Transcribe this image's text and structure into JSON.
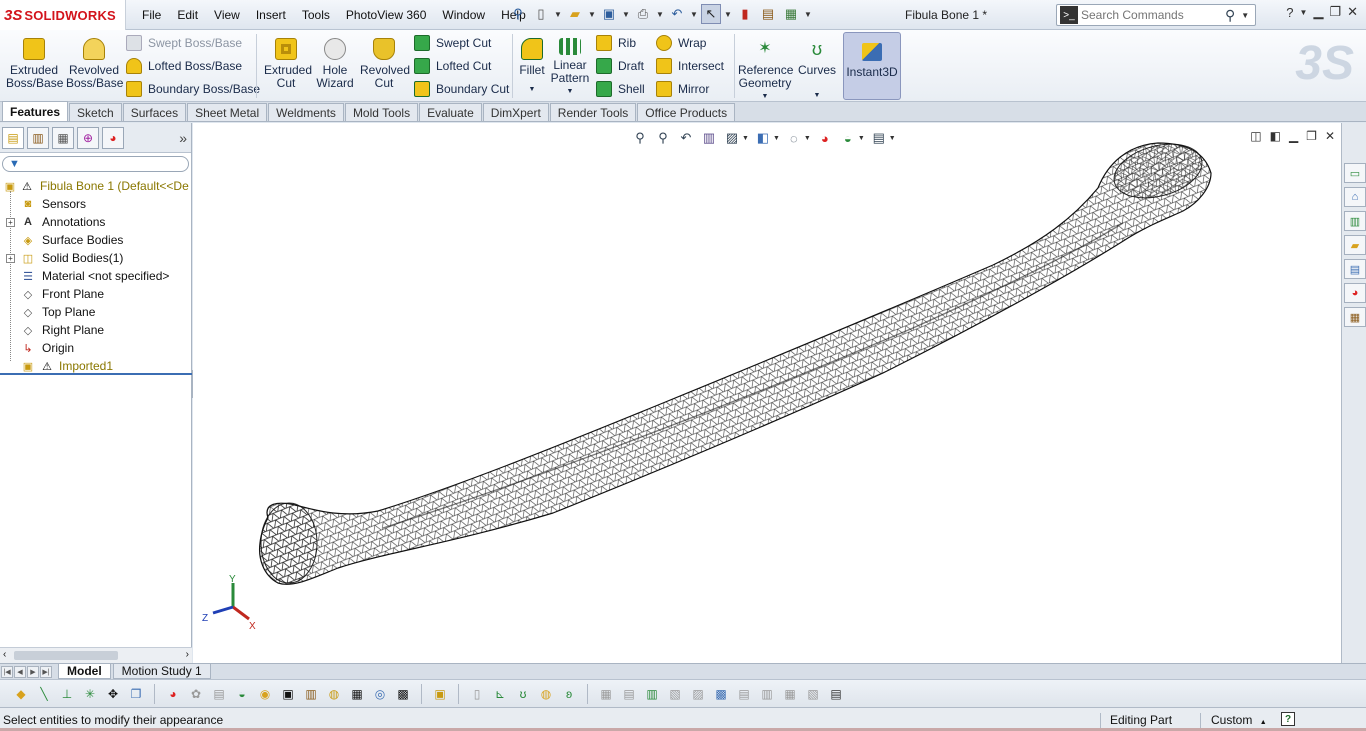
{
  "app": {
    "logo_mark": "3S",
    "logo_text": "SOLIDWORKS",
    "document_title": "Fibula Bone 1 *"
  },
  "menu": {
    "items": [
      "File",
      "Edit",
      "View",
      "Insert",
      "Tools",
      "PhotoView 360",
      "Window",
      "Help"
    ]
  },
  "search": {
    "placeholder": "Search Commands"
  },
  "command_manager": {
    "extruded_boss": "Extruded Boss/Base",
    "revolved_boss": "Revolved Boss/Base",
    "swept_boss": "Swept Boss/Base",
    "lofted_boss": "Lofted Boss/Base",
    "boundary_boss": "Boundary Boss/Base",
    "extruded_cut": "Extruded Cut",
    "hole_wizard": "Hole Wizard",
    "revolved_cut": "Revolved Cut",
    "swept_cut": "Swept Cut",
    "lofted_cut": "Lofted Cut",
    "boundary_cut": "Boundary Cut",
    "fillet": "Fillet",
    "linear_pattern": "Linear Pattern",
    "rib": "Rib",
    "draft": "Draft",
    "shell": "Shell",
    "wrap": "Wrap",
    "intersect": "Intersect",
    "mirror": "Mirror",
    "reference_geometry": "Reference Geometry",
    "curves": "Curves",
    "instant3d": "Instant3D"
  },
  "tabs": [
    "Features",
    "Sketch",
    "Surfaces",
    "Sheet Metal",
    "Weldments",
    "Mold Tools",
    "Evaluate",
    "DimXpert",
    "Render Tools",
    "Office Products"
  ],
  "feature_tree": {
    "root": "Fibula Bone 1  (Default<<De",
    "items": {
      "sensors": "Sensors",
      "annotations": "Annotations",
      "surface_bodies": "Surface Bodies",
      "solid_bodies": "Solid Bodies(1)",
      "material": "Material <not specified>",
      "front_plane": "Front Plane",
      "top_plane": "Top Plane",
      "right_plane": "Right Plane",
      "origin": "Origin",
      "imported": "Imported1"
    }
  },
  "triad": {
    "x": "X",
    "y": "Y",
    "z": "Z"
  },
  "bottom_tabs": [
    "Model",
    "Motion Study 1"
  ],
  "status": {
    "message": "Select entities to modify their appearance",
    "mode": "Editing Part",
    "units": "Custom",
    "help": "?"
  },
  "colors": {
    "brand": "#d3141c",
    "active_tab": "#ffffff",
    "instant3d_bg": "#c5cde6",
    "warning": "#f0c419"
  }
}
